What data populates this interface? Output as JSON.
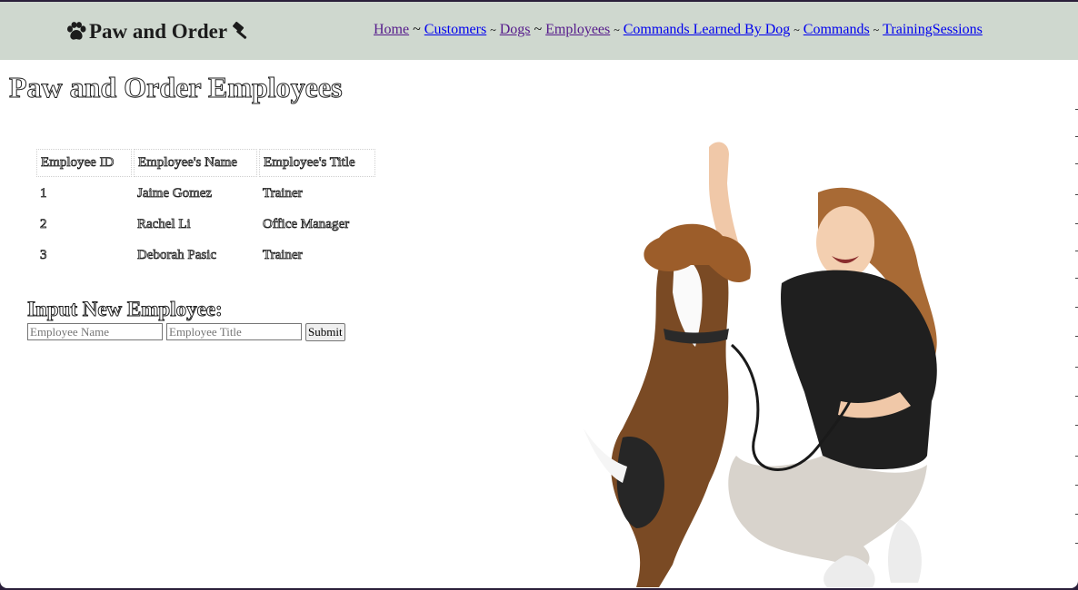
{
  "brand": {
    "name": "Paw and Order"
  },
  "nav": {
    "items": [
      {
        "label": "Home",
        "sep": "~"
      },
      {
        "label": "Customers",
        "sep": "~"
      },
      {
        "label": "Dogs",
        "sep": "~"
      },
      {
        "label": "Employees",
        "sep": "~"
      },
      {
        "label": "Commands Learned By Dog",
        "sep": "~"
      },
      {
        "label": "Commands",
        "sep": "~"
      },
      {
        "label": "TrainingSessions",
        "sep": ""
      }
    ]
  },
  "page": {
    "title": "Paw and Order Employees"
  },
  "table": {
    "headers": [
      "Employee ID",
      "Employee's Name",
      "Employee's Title"
    ],
    "rows": [
      [
        "1",
        "Jaime Gomez",
        "Trainer"
      ],
      [
        "2",
        "Rachel Li",
        "Office Manager"
      ],
      [
        "3",
        "Deborah Pasic",
        "Trainer"
      ]
    ]
  },
  "form": {
    "title": "Input New Employee:",
    "name_placeholder": "Employee Name",
    "title_placeholder": "Employee Title",
    "submit_label": "Submit"
  },
  "icons": {
    "brand_left": "paw-icon",
    "brand_right": "gavel-icon"
  },
  "colors": {
    "header_bg": "#cfd8cf",
    "link": "#0000ee",
    "visited_link": "#551a8b"
  }
}
